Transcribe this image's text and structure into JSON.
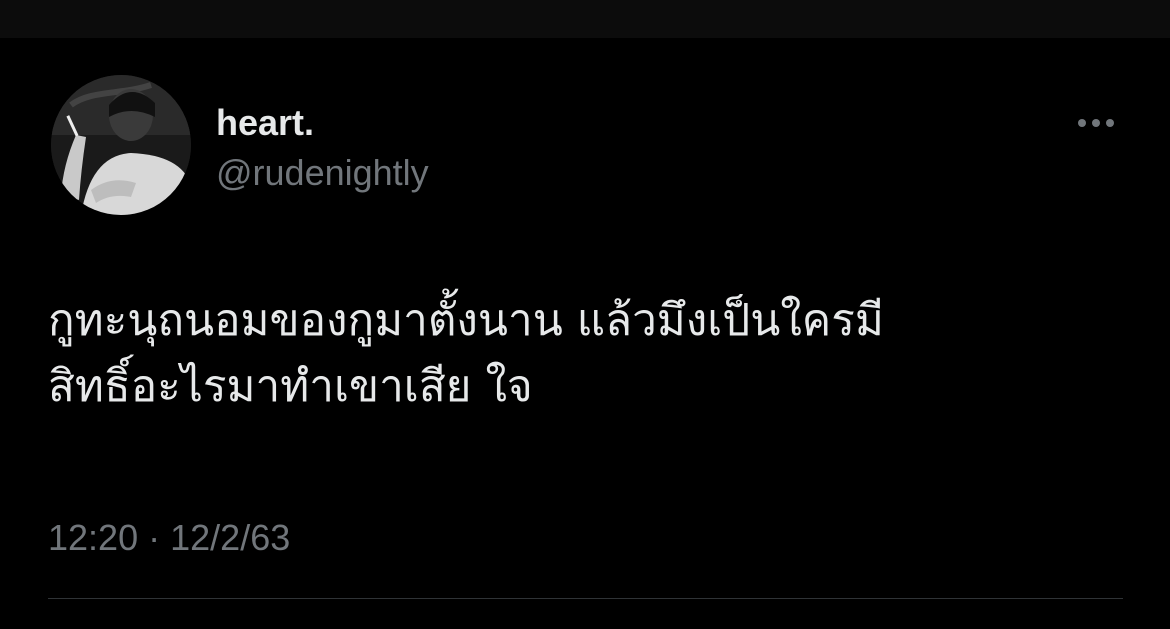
{
  "tweet": {
    "display_name": "heart.",
    "handle": "@rudenightly",
    "text": "กูทะนุถนอมของกูมาตั้งนาน แล้วมึงเป็นใครมี\nสิทธิ์อะไรมาทำเขาเสีย ใจ",
    "time": "12:20",
    "separator": "·",
    "date": "12/2/63",
    "more_icon": "more-horizontal-icon",
    "avatar": "grayscale-profile-photo"
  },
  "colors": {
    "background": "#000000",
    "text_primary": "#e7e9ea",
    "text_secondary": "#71767b",
    "divider": "#2f3336"
  }
}
